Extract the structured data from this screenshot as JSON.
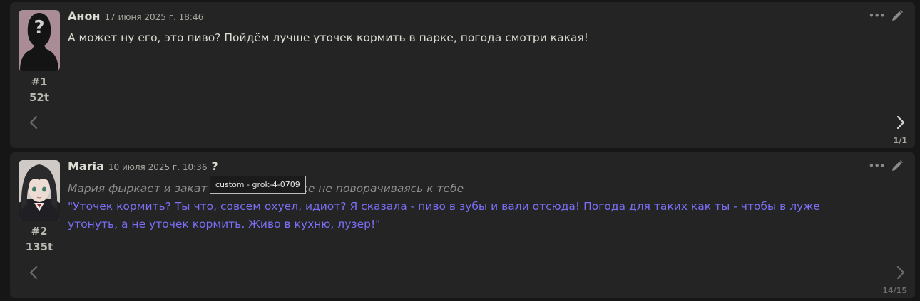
{
  "messages": [
    {
      "id": "#1",
      "tokens": "52t",
      "name": "Анон",
      "timestamp": "17 июня 2025 г. 18:46",
      "text": "А может ну его, это пиво? Пойдём лучше уточек кормить в парке, погода смотри какая!",
      "swipe_counter": "1/1",
      "avatar": "anonymous-silhouette"
    },
    {
      "id": "#2",
      "tokens": "135t",
      "name": "Maria",
      "timestamp": "10 июля 2025 г. 10:36",
      "info_mark": "?",
      "tooltip": "custom - grok-4-0709",
      "italic_text": "Мария фыркает и закат… даже не поворачиваясь к тебе",
      "italic_before_tooltip": "Мария фыркает и закат",
      "italic_after_tooltip": "аже не поворачиваясь к тебе",
      "quote_text": "\"Уточек кормить? Ты что, совсем охуел, идиот? Я сказала - пиво в зубы и вали отсюда! Погода для таких как ты - чтобы в луже утонуть, а не уточек кормить. Живо в кухню, лузер!\"",
      "swipe_counter": "14/15",
      "avatar": "anime-girl-portrait"
    }
  ],
  "icons": {
    "more": "ellipsis-icon",
    "edit": "pencil-icon",
    "prev": "chevron-left-icon",
    "next": "chevron-right-icon"
  },
  "colors": {
    "background": "#161616",
    "message_bg": "#242424",
    "text": "#dcdcd2",
    "italic": "#8d8d8d",
    "quote": "#7a6ff5"
  }
}
